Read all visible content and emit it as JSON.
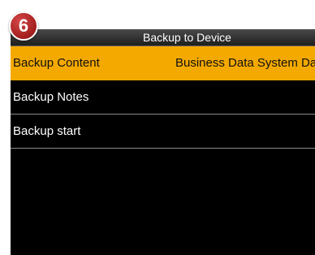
{
  "step_badge": "6",
  "header": {
    "title": "Backup to Device"
  },
  "menu": {
    "items": [
      {
        "label": "Backup Content",
        "value": "Business Data System Dat"
      },
      {
        "label": "Backup Notes",
        "value": ""
      },
      {
        "label": "Backup start",
        "value": ""
      }
    ]
  },
  "colors": {
    "selected_row": "#f4a900",
    "screen_background": "#000000",
    "badge": "#b52a2a"
  }
}
